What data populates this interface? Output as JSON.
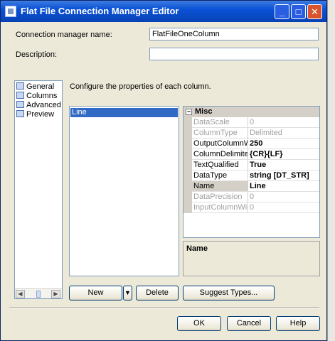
{
  "window": {
    "title": "Flat File Connection Manager Editor"
  },
  "titlebar_buttons": {
    "minimize": "_",
    "maximize": "□",
    "close": "✕"
  },
  "form": {
    "connection_name_label": "Connection manager name:",
    "connection_name_value": "FlatFileOneColumn",
    "description_label": "Description:",
    "description_value": ""
  },
  "nav": {
    "items": [
      {
        "label": "General",
        "icon": "general-icon"
      },
      {
        "label": "Columns",
        "icon": "columns-icon"
      },
      {
        "label": "Advanced",
        "icon": "advanced-icon"
      },
      {
        "label": "Preview",
        "icon": "preview-icon"
      }
    ],
    "selected": "Advanced"
  },
  "instructions": "Configure the properties of each column.",
  "columns": {
    "items": [
      "Line"
    ],
    "selected": "Line"
  },
  "properties": {
    "category": "Misc",
    "rows": [
      {
        "name": "DataScale",
        "value": "0",
        "disabled": true
      },
      {
        "name": "ColumnType",
        "value": "Delimited",
        "disabled": true
      },
      {
        "name": "OutputColumnWid",
        "value": "250",
        "disabled": false
      },
      {
        "name": "ColumnDelimiter",
        "value": "{CR}{LF}",
        "disabled": false
      },
      {
        "name": "TextQualified",
        "value": "True",
        "disabled": false
      },
      {
        "name": "DataType",
        "value": "string [DT_STR]",
        "disabled": false
      },
      {
        "name": "Name",
        "value": "Line",
        "disabled": false,
        "selected": true
      },
      {
        "name": "DataPrecision",
        "value": "0",
        "disabled": true
      },
      {
        "name": "InputColumnWidth",
        "value": "0",
        "disabled": true
      }
    ],
    "description_title": "Name"
  },
  "buttons": {
    "new": "New",
    "new_dropdown": "▼",
    "delete": "Delete",
    "suggest": "Suggest Types...",
    "ok": "OK",
    "cancel": "Cancel",
    "help": "Help"
  },
  "colors": {
    "titlebar": "#0a52d6",
    "selection": "#316ac5",
    "dialog_bg": "#ece9d8"
  }
}
